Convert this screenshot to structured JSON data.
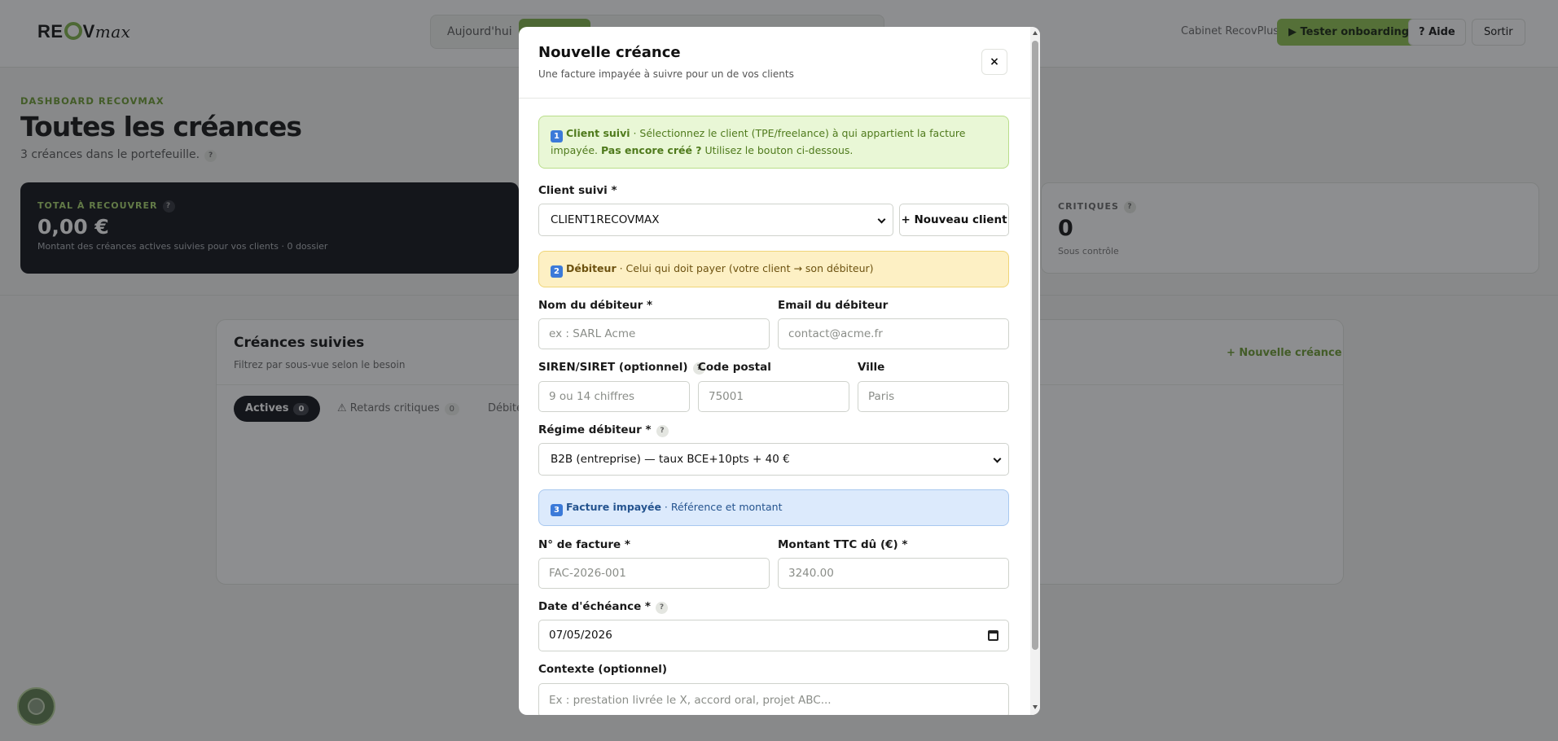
{
  "header": {
    "logo": {
      "text_a": "RE",
      "text_b": "V",
      "text_c": "max"
    },
    "segment": {
      "today": "Aujourd'hui"
    },
    "cabinet": "Cabinet RecovPlus",
    "onboarding_button": "▶ Tester onboarding",
    "help_button": "? Aide",
    "logout_button": "Sortir"
  },
  "dashboard": {
    "eyebrow": "DASHBOARD RECOVMAX",
    "title": "Toutes les créances",
    "subtitle": "3 créances dans le portefeuille.",
    "help": "?"
  },
  "cards": {
    "total": {
      "label": "TOTAL À RECOUVRER",
      "value": "0,00 €",
      "description": "Montant des créances actives suivies pour vos clients · 0 dossier"
    },
    "critical": {
      "label": "CRITIQUES",
      "value": "0",
      "description": "Sous contrôle"
    }
  },
  "panel": {
    "title": "Créances suivies",
    "subtitle": "Filtrez par sous-vue selon le besoin",
    "new_link": "+ Nouvelle créance",
    "tabs": [
      {
        "label": "Actives",
        "count": "0"
      },
      {
        "label": "⚠ Retards critiques",
        "count": "0"
      },
      {
        "label": "Débite"
      }
    ]
  },
  "modal": {
    "title": "Nouvelle créance",
    "subtitle": "Une facture impayée à suivre pour un de vos clients",
    "close": "×",
    "step1": {
      "badge": "1",
      "strong": "Client suivi",
      "text": " · Sélectionnez le client (TPE/freelance) à qui appartient la facture impayée. ",
      "strong2": "Pas encore créé ?",
      "text2": " Utilisez le bouton ci-dessous."
    },
    "client_label": "Client suivi *",
    "client_value": "CLIENT1RECOVMAX",
    "new_client_button": "+ Nouveau client",
    "step2": {
      "badge": "2",
      "strong": "Débiteur",
      "text": " · Celui qui doit payer (votre client → son débiteur)"
    },
    "debtor_name_label": "Nom du débiteur *",
    "debtor_name_placeholder": "ex : SARL Acme",
    "debtor_email_label": "Email du débiteur",
    "debtor_email_placeholder": "contact@acme.fr",
    "siren_label": "SIREN/SIRET (optionnel)",
    "siren_placeholder": "9 ou 14 chiffres",
    "postal_label": "Code postal",
    "postal_placeholder": "75001",
    "city_label": "Ville",
    "city_placeholder": "Paris",
    "regime_label": "Régime débiteur *",
    "regime_value": "B2B (entreprise) — taux BCE+10pts + 40 €",
    "step3": {
      "badge": "3",
      "strong": "Facture impayée",
      "text": " · Référence et montant"
    },
    "invoice_label": "N° de facture *",
    "invoice_placeholder": "FAC-2026-001",
    "amount_label": "Montant TTC dû (€) *",
    "amount_placeholder": "3240.00",
    "due_date_label": "Date d'échéance *",
    "due_date_value": "07/05/2026",
    "context_label": "Contexte (optionnel)",
    "context_placeholder": "Ex : prestation livrée le X, accord oral, projet ABC..."
  },
  "colors": {
    "accent": "#7fb347",
    "dark": "#0d0f14",
    "note_green": "#e9f7d6",
    "note_yellow": "#fdf0c4",
    "note_blue": "#dceafc"
  },
  "icons": [
    "help-icon",
    "close-icon",
    "chevron-down-icon",
    "calendar-icon",
    "play-icon",
    "warning-icon",
    "assistant-icon"
  ]
}
